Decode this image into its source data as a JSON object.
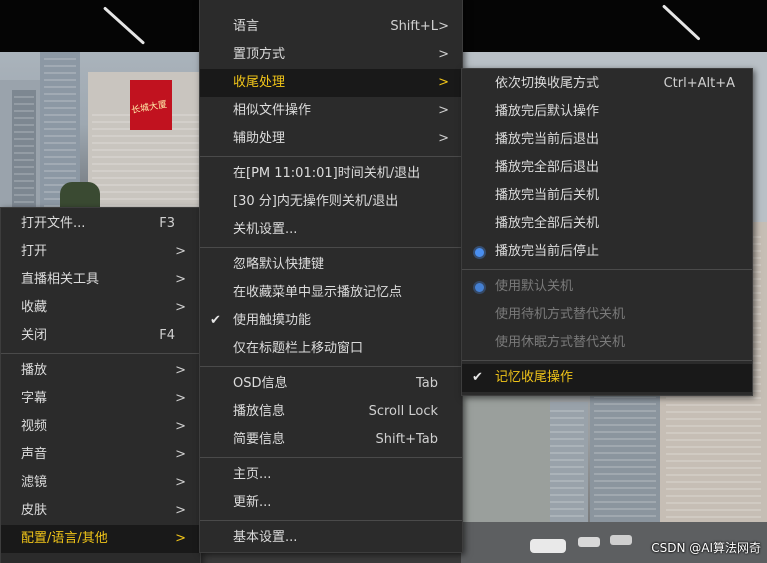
{
  "left_menu": {
    "items": [
      {
        "label": "打开文件...",
        "shortcut": "F3"
      },
      {
        "label": "打开",
        "arrow": ">"
      },
      {
        "label": "直播相关工具",
        "arrow": ">"
      },
      {
        "label": "收藏",
        "arrow": ">"
      },
      {
        "label": "关闭",
        "shortcut": "F4"
      },
      {
        "label": "播放",
        "arrow": ">"
      },
      {
        "label": "字幕",
        "arrow": ">"
      },
      {
        "label": "视频",
        "arrow": ">"
      },
      {
        "label": "声音",
        "arrow": ">"
      },
      {
        "label": "滤镜",
        "arrow": ">"
      },
      {
        "label": "皮肤",
        "arrow": ">"
      },
      {
        "label": "配置/语言/其他",
        "arrow": ">"
      }
    ]
  },
  "middle_menu": {
    "items": [
      {
        "label": "语言",
        "shortcut": "Shift+L",
        "arrow": ">"
      },
      {
        "label": "置顶方式",
        "arrow": ">"
      },
      {
        "label": "收尾处理",
        "arrow": ">"
      },
      {
        "label": "相似文件操作",
        "arrow": ">"
      },
      {
        "label": "辅助处理",
        "arrow": ">"
      },
      {
        "label": "在[PM 11:01:01]时间关机/退出"
      },
      {
        "label": "[30 分]内无操作则关机/退出"
      },
      {
        "label": "关机设置..."
      },
      {
        "label": "忽略默认快捷键"
      },
      {
        "label": "在收藏菜单中显示播放记忆点"
      },
      {
        "label": "使用触摸功能",
        "check": "✔"
      },
      {
        "label": "仅在标题栏上移动窗口"
      },
      {
        "label": "OSD信息",
        "shortcut": "Tab"
      },
      {
        "label": "播放信息",
        "shortcut": "Scroll Lock"
      },
      {
        "label": "简要信息",
        "shortcut": "Shift+Tab"
      },
      {
        "label": "主页..."
      },
      {
        "label": "更新..."
      },
      {
        "label": "基本设置..."
      }
    ]
  },
  "right_menu": {
    "items": [
      {
        "label": "依次切换收尾方式",
        "shortcut": "Ctrl+Alt+A"
      },
      {
        "label": "播放完后默认操作"
      },
      {
        "label": "播放完当前后退出"
      },
      {
        "label": "播放完全部后退出"
      },
      {
        "label": "播放完当前后关机"
      },
      {
        "label": "播放完全部后关机"
      },
      {
        "label": "播放完当前后停止"
      },
      {
        "label": "使用默认关机"
      },
      {
        "label": "使用待机方式替代关机"
      },
      {
        "label": "使用休眠方式替代关机"
      },
      {
        "label": "记忆收尾操作",
        "check": "✔"
      }
    ]
  },
  "video_sign_text": "长城大厦",
  "watermark": "CSDN @AI算法网奇",
  "colors": {
    "menu_bg": "#2b2b2b",
    "highlight_text": "#f0c419",
    "radio_accent": "#4a8ff0"
  }
}
